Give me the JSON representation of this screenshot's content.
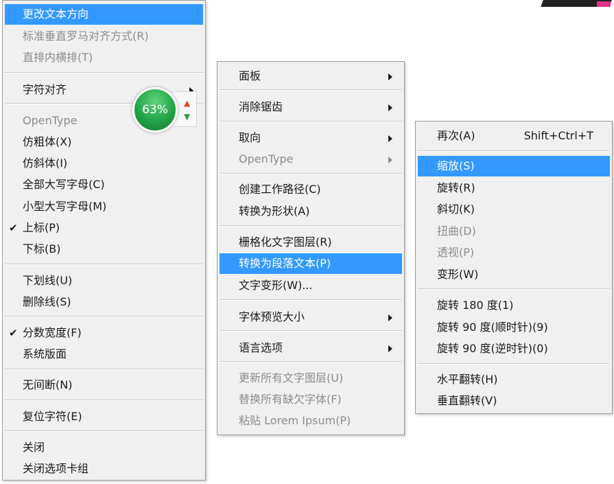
{
  "menu1": {
    "items": [
      {
        "label": "更改文本方向",
        "state": "highlighted"
      },
      {
        "label": "标准垂直罗马对齐方式(R)",
        "state": "disabled"
      },
      {
        "label": "直排内横排(T)",
        "state": "disabled"
      },
      {
        "label": "字符对齐",
        "state": "normal",
        "submenu": true
      },
      {
        "label": "OpenType",
        "state": "disabled"
      },
      {
        "label": "仿粗体(X)",
        "state": "normal"
      },
      {
        "label": "仿斜体(I)",
        "state": "normal"
      },
      {
        "label": "全部大写字母(C)",
        "state": "normal"
      },
      {
        "label": "小型大写字母(M)",
        "state": "normal"
      },
      {
        "label": "上标(P)",
        "state": "checked"
      },
      {
        "label": "下标(B)",
        "state": "normal"
      },
      {
        "label": "下划线(U)",
        "state": "normal"
      },
      {
        "label": "删除线(S)",
        "state": "normal"
      },
      {
        "label": "分数宽度(F)",
        "state": "checked"
      },
      {
        "label": "系统版面",
        "state": "normal"
      },
      {
        "label": "无间断(N)",
        "state": "normal"
      },
      {
        "label": "复位字符(E)",
        "state": "normal"
      },
      {
        "label": "关闭",
        "state": "normal"
      },
      {
        "label": "关闭选项卡组",
        "state": "normal"
      }
    ]
  },
  "menu2": {
    "items": [
      {
        "label": "面板",
        "submenu": true
      },
      {
        "label": "消除锯齿",
        "submenu": true
      },
      {
        "label": "取向",
        "submenu": true
      },
      {
        "label": "OpenType",
        "submenu": true,
        "state": "disabled"
      },
      {
        "label": "创建工作路径(C)"
      },
      {
        "label": "转换为形状(A)"
      },
      {
        "label": "栅格化文字图层(R)"
      },
      {
        "label": "转换为段落文本(P)",
        "state": "highlighted"
      },
      {
        "label": "文字变形(W)..."
      },
      {
        "label": "字体预览大小",
        "submenu": true
      },
      {
        "label": "语言选项",
        "submenu": true
      },
      {
        "label": "更新所有文字图层(U)",
        "state": "disabled"
      },
      {
        "label": "替换所有缺欠字体(F)",
        "state": "disabled"
      },
      {
        "label": "粘贴 Lorem Ipsum(P)",
        "state": "disabled"
      }
    ]
  },
  "menu3": {
    "items": [
      {
        "label": "再次(A)",
        "shortcut": "Shift+Ctrl+T"
      },
      {
        "label": "缩放(S)",
        "state": "highlighted"
      },
      {
        "label": "旋转(R)"
      },
      {
        "label": "斜切(K)"
      },
      {
        "label": "扭曲(D)",
        "state": "disabled"
      },
      {
        "label": "透视(P)",
        "state": "disabled"
      },
      {
        "label": "变形(W)"
      },
      {
        "label": "旋转 180 度(1)"
      },
      {
        "label": "旋转 90 度(顺时针)(9)"
      },
      {
        "label": "旋转 90 度(逆时针)(0)"
      },
      {
        "label": "水平翻转(H)"
      },
      {
        "label": "垂直翻转(V)"
      }
    ]
  },
  "badge": {
    "percent": "63%",
    "icons": [
      "up-arrow-icon",
      "down-arrow-icon"
    ]
  },
  "colors": {
    "highlight": "#3399ff",
    "menu_bg": "#f0f0f0",
    "disabled": "#8c8c8c",
    "badge_green": "#22a447"
  }
}
